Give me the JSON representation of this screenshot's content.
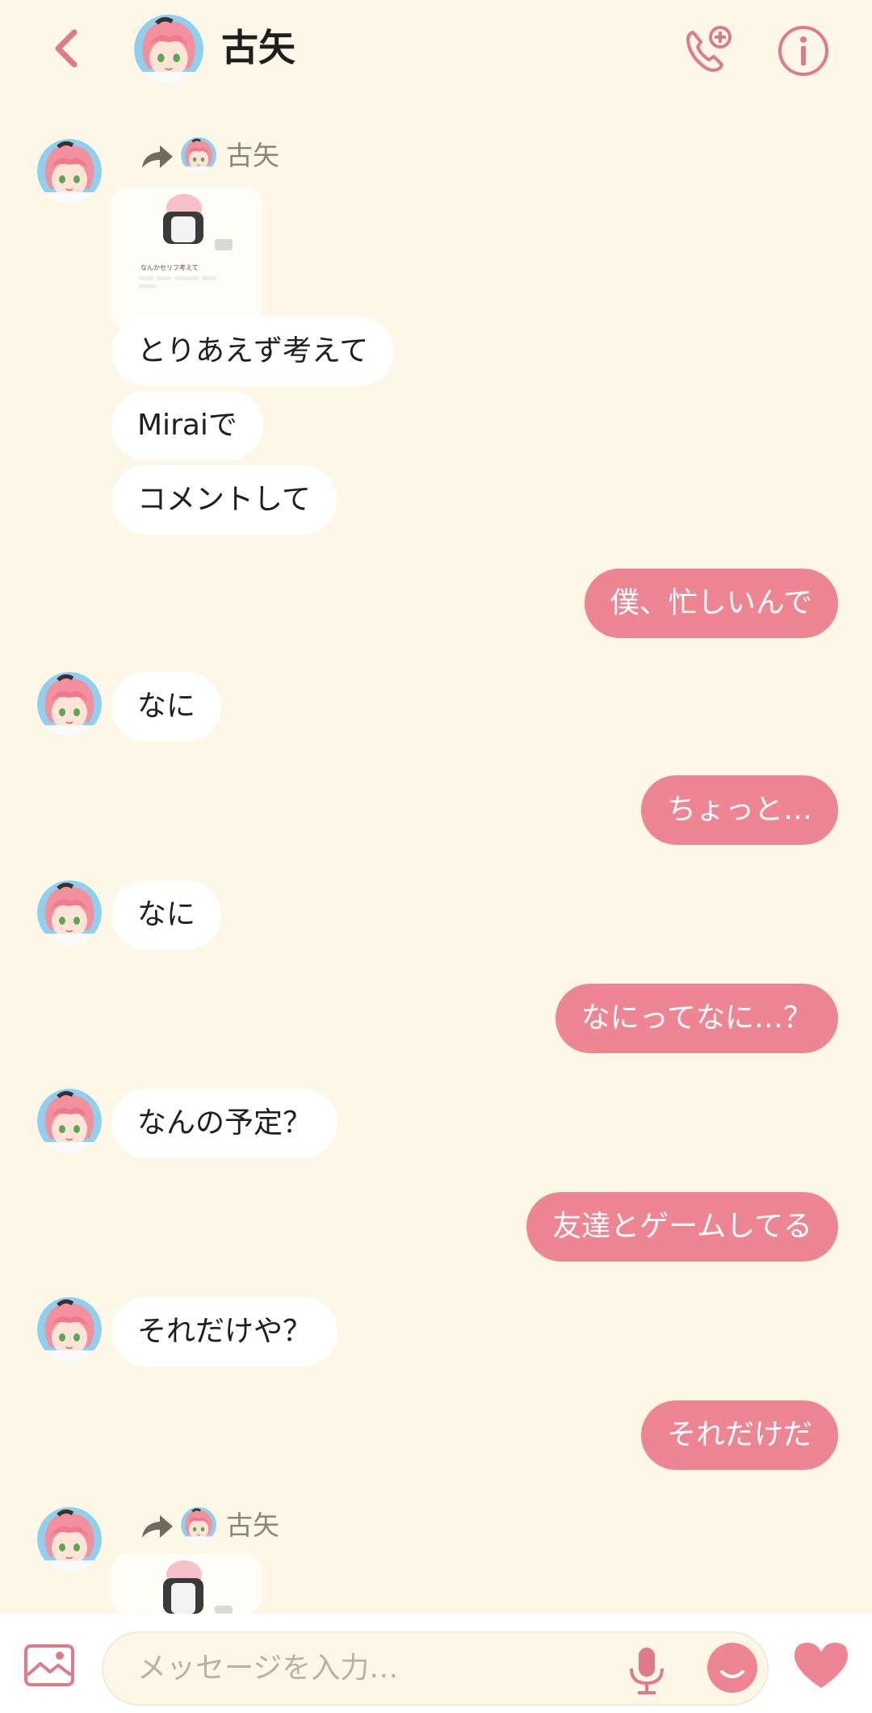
{
  "header": {
    "title": "古矢"
  },
  "forward_1": {
    "name": "古矢",
    "card_title": "なんかセリフ考えて"
  },
  "forward_2": {
    "name": "古矢"
  },
  "messages": [
    {
      "dir": "in",
      "text": "とりあえず考えて"
    },
    {
      "dir": "in",
      "text": "Miraiで"
    },
    {
      "dir": "in",
      "text": "コメントして"
    },
    {
      "dir": "out",
      "text": "僕、忙しいんで"
    },
    {
      "dir": "in",
      "text": "なに"
    },
    {
      "dir": "out",
      "text": "ちょっと…"
    },
    {
      "dir": "in",
      "text": "なに"
    },
    {
      "dir": "out",
      "text": "なにってなに…？"
    },
    {
      "dir": "in",
      "text": "なんの予定？"
    },
    {
      "dir": "out",
      "text": "友達とゲームしてる"
    },
    {
      "dir": "in",
      "text": "それだけや？"
    },
    {
      "dir": "out",
      "text": "それだけだ"
    }
  ],
  "composer": {
    "placeholder": "メッセージを入力…"
  },
  "colors": {
    "background": "#fdf7e8",
    "accent": "#ee8592",
    "incoming_bubble": "#ffffff",
    "outgoing_bubble": "#ee8592"
  },
  "icons": {
    "back": "chevron-left-icon",
    "call": "phone-plus-icon",
    "info": "info-icon",
    "forward": "forward-arrow-icon",
    "gallery": "image-icon",
    "mic": "microphone-icon",
    "emoji": "smiley-icon",
    "like": "heart-icon"
  }
}
